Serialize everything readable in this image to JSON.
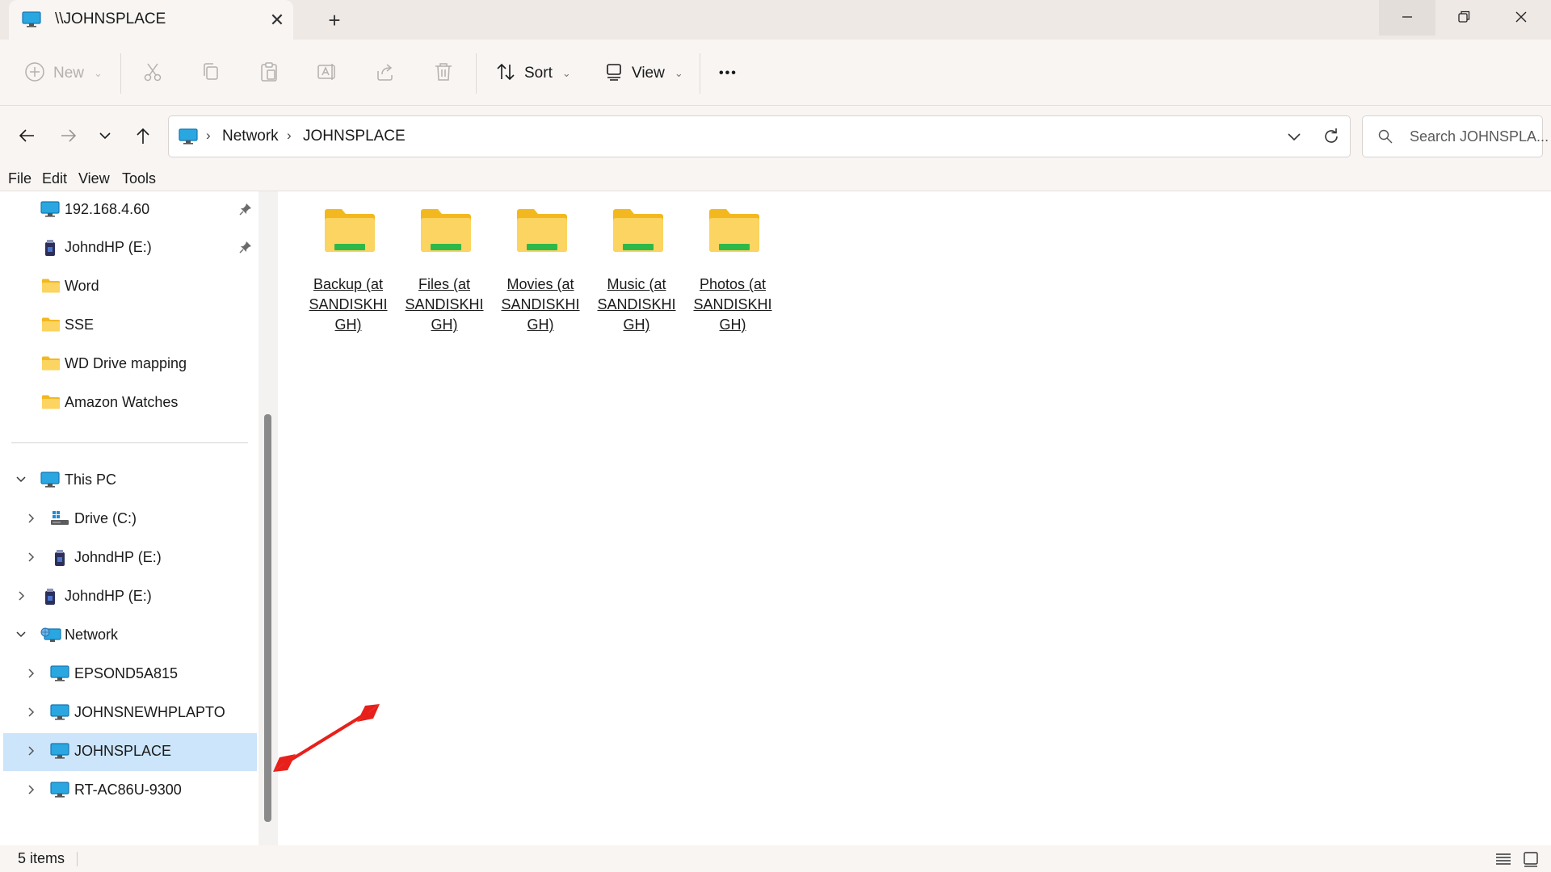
{
  "window": {
    "tab_title": "\\\\JOHNSPLACE",
    "tab_icon": "monitor-icon",
    "new_tab": "+",
    "close_tab": "✕"
  },
  "toolbar": {
    "new_label": "New",
    "sort_label": "Sort",
    "view_label": "View",
    "more_label": "•••"
  },
  "address": {
    "crumbs": [
      "Network",
      "JOHNSPLACE"
    ],
    "search_placeholder": "Search JOHNSPLA..."
  },
  "menu": [
    "File",
    "Edit",
    "View",
    "Tools"
  ],
  "sidebar": {
    "quick_access": [
      {
        "label": "192.168.4.60",
        "icon": "monitor-icon",
        "pinned": true
      },
      {
        "label": "JohndHP (E:)",
        "icon": "usb-drive-icon",
        "pinned": true
      },
      {
        "label": "Word",
        "icon": "folder-icon"
      },
      {
        "label": "SSE",
        "icon": "folder-icon"
      },
      {
        "label": "WD Drive mapping",
        "icon": "folder-icon"
      },
      {
        "label": "Amazon Watches",
        "icon": "folder-icon"
      }
    ],
    "tree": [
      {
        "label": "This PC",
        "icon": "monitor-icon",
        "expanded": true,
        "level": 0
      },
      {
        "label": "Drive (C:)",
        "icon": "windows-drive-icon",
        "level": 1
      },
      {
        "label": "JohndHP (E:)",
        "icon": "usb-drive-icon",
        "level": 1
      },
      {
        "label": "JohndHP (E:)",
        "icon": "usb-drive-icon",
        "level": 0
      },
      {
        "label": "Network",
        "icon": "network-icon",
        "expanded": true,
        "level": 0
      },
      {
        "label": "EPSOND5A815",
        "icon": "monitor-icon",
        "level": 1
      },
      {
        "label": "JOHNSNEWHPLAPTO",
        "icon": "monitor-icon",
        "level": 1
      },
      {
        "label": "JOHNSPLACE",
        "icon": "monitor-icon",
        "level": 1,
        "selected": true
      },
      {
        "label": "RT-AC86U-9300",
        "icon": "monitor-icon",
        "level": 1
      }
    ]
  },
  "content": {
    "folders": [
      {
        "line1": "Backup (at",
        "line2": "SANDISKHI",
        "line3": "GH)"
      },
      {
        "line1": "Files (at",
        "line2": "SANDISKHI",
        "line3": "GH)"
      },
      {
        "line1": "Movies (at",
        "line2": "SANDISKHI",
        "line3": "GH)"
      },
      {
        "line1": "Music (at",
        "line2": "SANDISKHI",
        "line3": "GH)"
      },
      {
        "line1": "Photos (at",
        "line2": "SANDISKHI",
        "line3": "GH)"
      }
    ]
  },
  "status": {
    "item_count": "5 items"
  },
  "colors": {
    "selection": "#cce5fb",
    "folder": "#f7c948",
    "network_share_bar": "#2fb84a",
    "annotation_arrow": "#e8201b"
  }
}
